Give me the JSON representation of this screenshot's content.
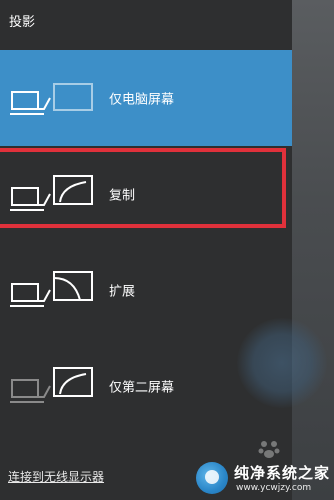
{
  "panel": {
    "title": "投影",
    "options": [
      {
        "label": "仅电脑屏幕",
        "selected": true
      },
      {
        "label": "复制",
        "selected": false
      },
      {
        "label": "扩展",
        "selected": false
      },
      {
        "label": "仅第二屏幕",
        "selected": false
      }
    ],
    "connect_link": "连接到无线显示器"
  },
  "watermark": {
    "name": "纯净系统之家",
    "url": "www.ycwjzy.com"
  },
  "colors": {
    "selected": "#3d8fc8",
    "highlight": "#e0313b",
    "panel": "#2e2f30"
  }
}
